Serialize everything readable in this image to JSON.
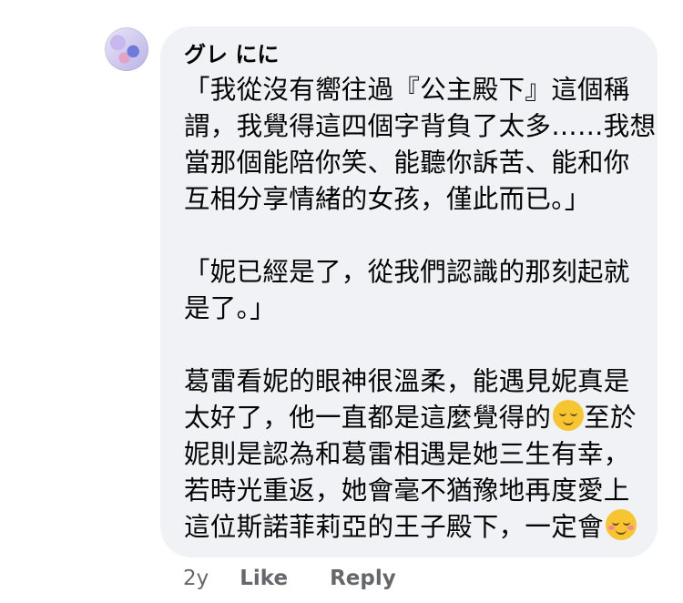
{
  "comment": {
    "author": "グレ にに",
    "paragraphs": [
      [
        "「我從沒有嚮往過『公主殿下』這個稱",
        "謂，我覺得這四個字背負了太多……我想",
        "當那個能陪你笑、能聽你訴苦、能和你",
        "互相分享情緒的女孩，僅此而已。」"
      ],
      [
        "「妮已經是了，從我們認識的那刻起就",
        "是了。」"
      ],
      [
        "葛雷看妮的眼神很溫柔，能遇見妮真是",
        "太好了，他一直都是這麼覺得的",
        "妮則是認為和葛雷相遇是她三生有幸，",
        "若時光重返，她會毫不猶豫地再度愛上",
        "這位斯諾菲莉亞的王子殿下，一定會"
      ]
    ],
    "line12_suffix": "至於",
    "emoji_1": "relieved-face-emoji",
    "emoji_2": "smiling-face-emoji"
  },
  "actions": {
    "time": "2y",
    "like": "Like",
    "reply": "Reply"
  }
}
